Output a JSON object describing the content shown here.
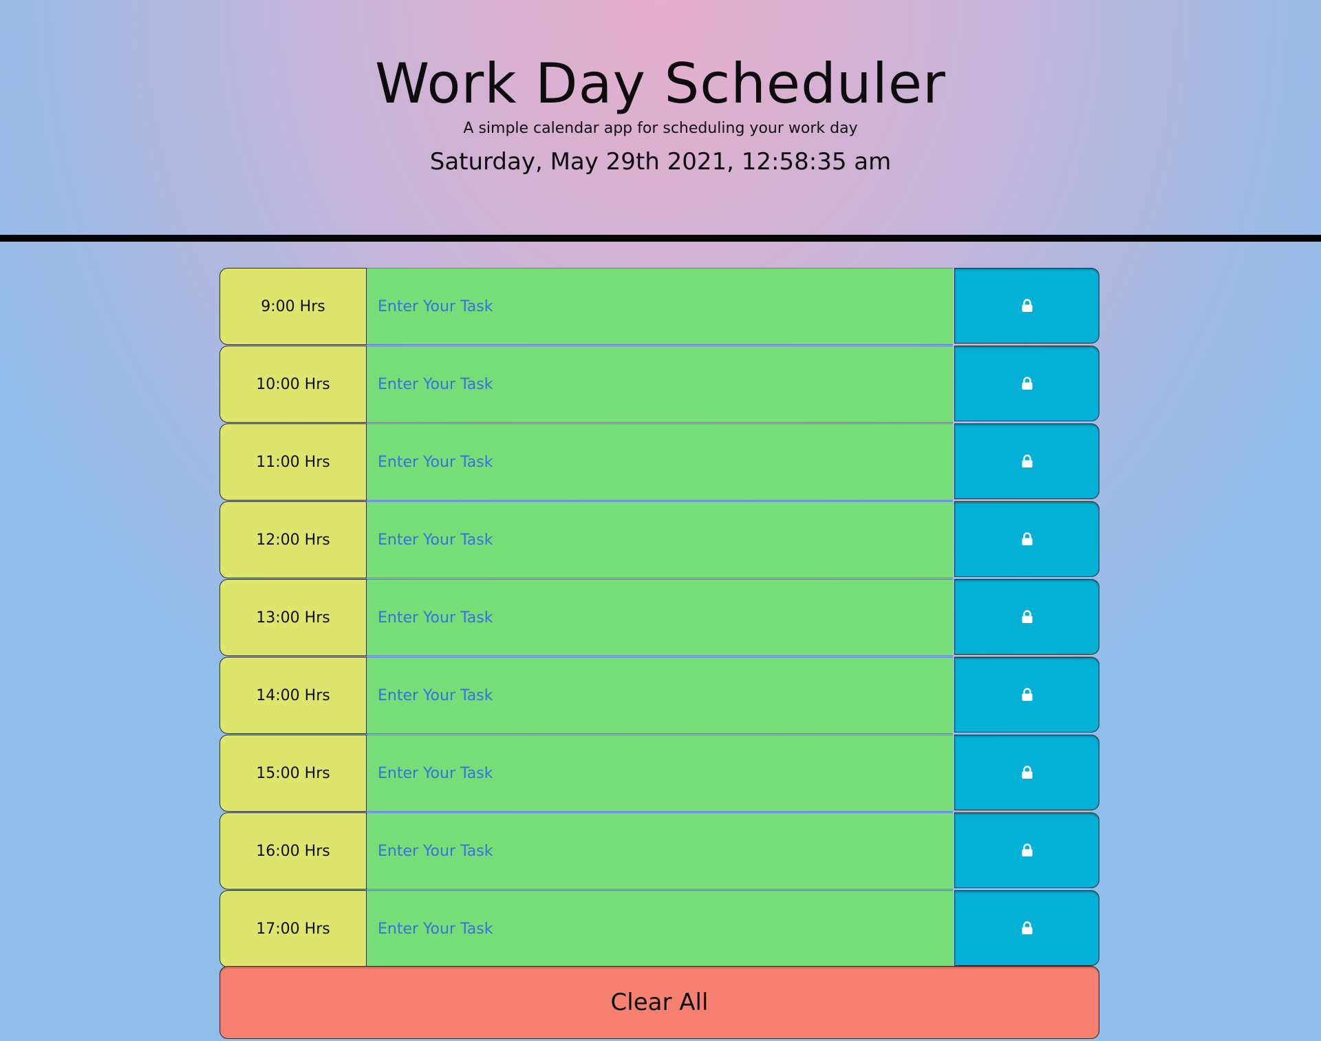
{
  "header": {
    "title": "Work Day Scheduler",
    "subtitle": "A simple calendar app for scheduling your work day",
    "datetime": "Saturday, May 29th 2021, 12:58:35 am"
  },
  "task_placeholder": "Enter Your Task",
  "rows": [
    {
      "hour": "9:00 Hrs",
      "task": ""
    },
    {
      "hour": "10:00 Hrs",
      "task": ""
    },
    {
      "hour": "11:00 Hrs",
      "task": ""
    },
    {
      "hour": "12:00 Hrs",
      "task": ""
    },
    {
      "hour": "13:00 Hrs",
      "task": ""
    },
    {
      "hour": "14:00 Hrs",
      "task": ""
    },
    {
      "hour": "15:00 Hrs",
      "task": ""
    },
    {
      "hour": "16:00 Hrs",
      "task": ""
    },
    {
      "hour": "17:00 Hrs",
      "task": ""
    }
  ],
  "save_icon": "lock-icon",
  "clear_label": "Clear All",
  "colors": {
    "hour_block": "#dde56c",
    "task_future": "#77dd77",
    "save_button": "#05b0d6",
    "clear_button": "#f88071",
    "divider": "#050505"
  }
}
